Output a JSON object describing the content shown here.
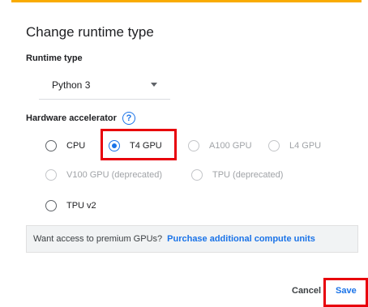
{
  "dialog": {
    "title": "Change runtime type",
    "runtime_label": "Runtime type",
    "runtime_value": "Python 3",
    "hardware_label": "Hardware accelerator",
    "help_glyph": "?",
    "accelerators": [
      {
        "label": "CPU",
        "selected": false,
        "disabled": false
      },
      {
        "label": "T4 GPU",
        "selected": true,
        "disabled": false
      },
      {
        "label": "A100 GPU",
        "selected": false,
        "disabled": true
      },
      {
        "label": "L4 GPU",
        "selected": false,
        "disabled": true
      },
      {
        "label": "V100 GPU (deprecated)",
        "selected": false,
        "disabled": true
      },
      {
        "label": "TPU (deprecated)",
        "selected": false,
        "disabled": true
      },
      {
        "label": "TPU v2",
        "selected": false,
        "disabled": false
      }
    ],
    "banner_text": "Want access to premium GPUs?",
    "banner_link": "Purchase additional compute units",
    "cancel_label": "Cancel",
    "save_label": "Save"
  },
  "colors": {
    "accent": "#1a73e8",
    "top_bar": "#f9ab00",
    "highlight": "#e8000b"
  }
}
